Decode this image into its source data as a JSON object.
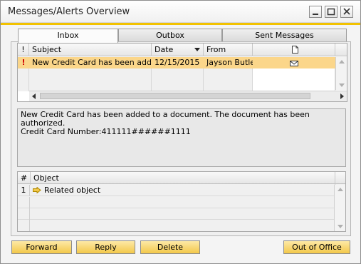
{
  "window": {
    "title": "Messages/Alerts Overview"
  },
  "tabs": [
    {
      "label": "Inbox"
    },
    {
      "label": "Outbox"
    },
    {
      "label": "Sent Messages"
    }
  ],
  "inbox": {
    "columns": [
      "!",
      "Subject",
      "Date",
      "From",
      "attachment-icon"
    ],
    "rows": [
      {
        "flag": "!",
        "subject": "New Credit Card has been added",
        "date": "12/15/2015",
        "from": "Jayson Butler",
        "icon": "envelope-icon"
      }
    ]
  },
  "message": {
    "line1": "New Credit Card has been added to a document. The document has been authorized.",
    "line2": "Credit Card Number:411111######1111"
  },
  "objects": {
    "columns": [
      "#",
      "Object"
    ],
    "rows": [
      {
        "num": "1",
        "label": "Related object",
        "icon": "arrow-right-icon"
      }
    ]
  },
  "buttons": {
    "forward": "Forward",
    "reply": "Reply",
    "delete": "Delete",
    "out_of_office": "Out of Office"
  },
  "colors": {
    "accent": "#f2c200",
    "selection": "#fbd68a",
    "button": "#f3c84a"
  }
}
